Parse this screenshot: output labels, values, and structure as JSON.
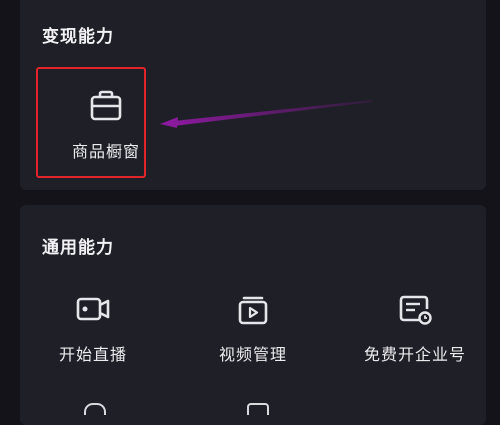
{
  "monetize": {
    "title": "变现能力",
    "items": [
      {
        "label": "商品橱窗",
        "icon": "shop-window-icon"
      }
    ],
    "highlight_color": "#e3242b",
    "arrow_color": "#8a1a9c"
  },
  "general": {
    "title": "通用能力",
    "items": [
      {
        "label": "开始直播",
        "icon": "live-camera-icon"
      },
      {
        "label": "视频管理",
        "icon": "video-manage-icon"
      },
      {
        "label": "免费开企业号",
        "icon": "enterprise-account-icon"
      }
    ]
  },
  "theme": {
    "background": "#131319",
    "card": "#1f1f27",
    "text": "#ffffff"
  }
}
